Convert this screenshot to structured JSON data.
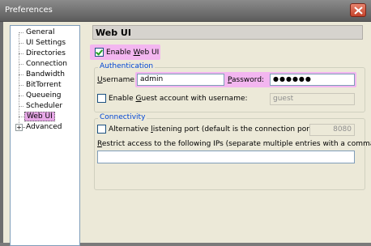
{
  "window": {
    "title": "Preferences"
  },
  "tree": {
    "items": [
      {
        "label": "General"
      },
      {
        "label": "UI Settings"
      },
      {
        "label": "Directories"
      },
      {
        "label": "Connection"
      },
      {
        "label": "Bandwidth"
      },
      {
        "label": "BitTorrent"
      },
      {
        "label": "Queueing"
      },
      {
        "label": "Scheduler"
      },
      {
        "label": "Web UI",
        "selected": true
      },
      {
        "label": "Advanced",
        "expandable": true
      }
    ],
    "expander_glyph": "+"
  },
  "panel": {
    "title": "Web UI",
    "enable_label_pre": "Enable ",
    "enable_label_u": "W",
    "enable_label_post": "eb UI",
    "enable_checked": true,
    "auth": {
      "title": "Authentication",
      "username_label_u": "U",
      "username_label_rest": "sername:",
      "username_value": "admin",
      "password_label_u": "P",
      "password_label_rest": "assword:",
      "password_value": "●●●●●●",
      "guest_label_pre": "Enable ",
      "guest_label_u": "G",
      "guest_label_post": "uest account with username:",
      "guest_checked": false,
      "guest_value": "guest"
    },
    "conn": {
      "title": "Connectivity",
      "alt_port_pre": "Alternative ",
      "alt_port_u": "l",
      "alt_port_post": "istening port (default is the connection port):",
      "alt_port_checked": false,
      "alt_port_value": "8080",
      "restrict_u": "R",
      "restrict_rest": "estrict access to the following IPs (separate multiple entries with a comma):",
      "restrict_value": ""
    }
  },
  "colors": {
    "highlight": "#f3b6f0",
    "group_title": "#0046d5",
    "titlebar": "#6d6d6d",
    "close": "#c5432b"
  }
}
